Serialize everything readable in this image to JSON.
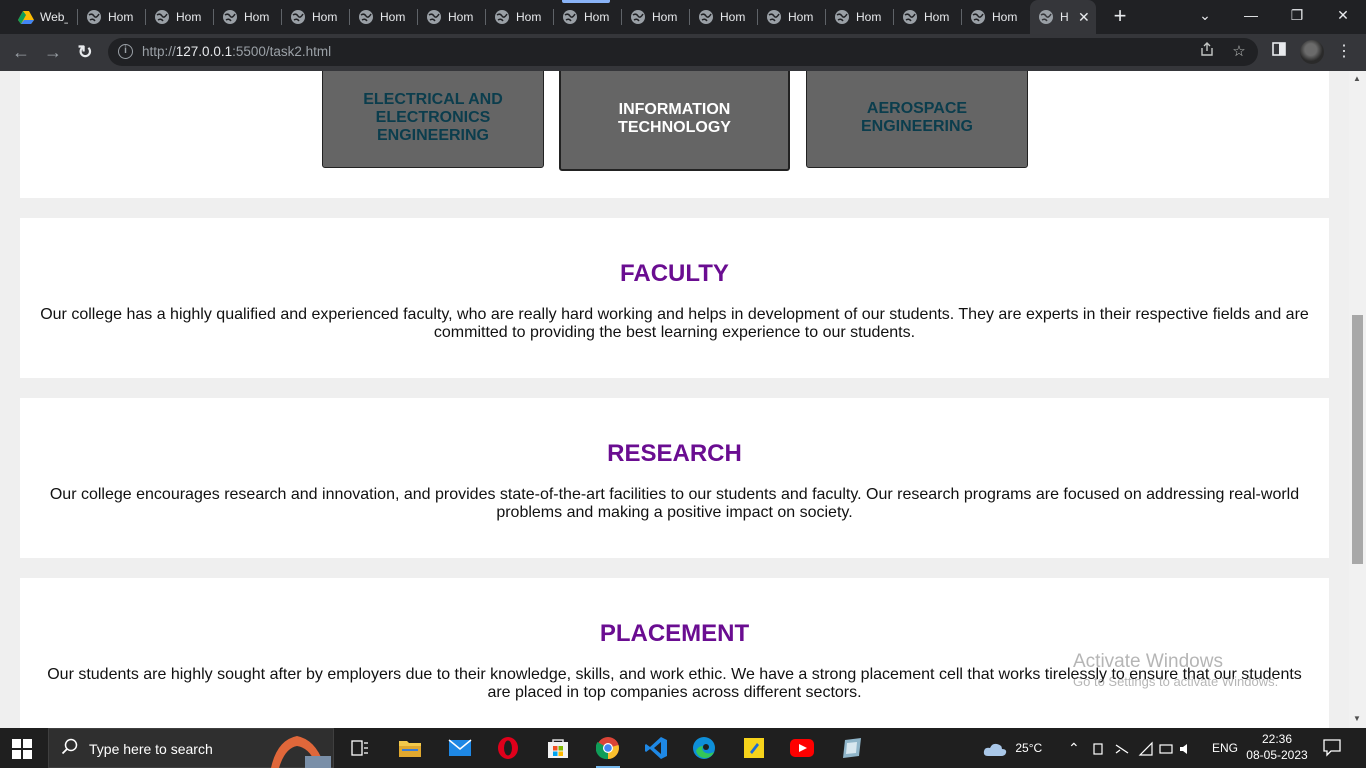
{
  "browser": {
    "tabs": [
      {
        "title": "Web_",
        "icon": "google-drive-icon"
      },
      {
        "title": "Hom",
        "icon": "globe-icon"
      },
      {
        "title": "Hom",
        "icon": "globe-icon"
      },
      {
        "title": "Hom",
        "icon": "globe-icon"
      },
      {
        "title": "Hom",
        "icon": "globe-icon"
      },
      {
        "title": "Hom",
        "icon": "globe-icon"
      },
      {
        "title": "Hom",
        "icon": "globe-icon"
      },
      {
        "title": "Hom",
        "icon": "globe-icon"
      },
      {
        "title": "Hom",
        "icon": "globe-icon"
      },
      {
        "title": "Hom",
        "icon": "globe-icon"
      },
      {
        "title": "Hom",
        "icon": "globe-icon"
      },
      {
        "title": "Hom",
        "icon": "globe-icon"
      },
      {
        "title": "Hom",
        "icon": "globe-icon"
      },
      {
        "title": "Hom",
        "icon": "globe-icon"
      },
      {
        "title": "Hom",
        "icon": "globe-icon"
      }
    ],
    "active_tab": {
      "title": "H",
      "close": "✕"
    },
    "new_tab": "+",
    "window_controls": {
      "dropdown": "⌄",
      "minimize": "—",
      "restore": "❐",
      "close": "✕"
    },
    "address": {
      "prefix": "http://",
      "host": "127.0.0.1",
      "rest": ":5500/task2.html"
    },
    "nav": {
      "back": "←",
      "forward": "→",
      "reload": "↻"
    }
  },
  "page": {
    "departments": [
      {
        "label": "ELECTRICAL AND ELECTRONICS ENGINEERING",
        "style": "dark"
      },
      {
        "label": "INFORMATION TECHNOLOGY",
        "style": "light"
      },
      {
        "label": "AEROSPACE ENGINEERING",
        "style": "dark"
      }
    ],
    "faculty": {
      "title": "FACULTY",
      "text": "Our college has a highly qualified and experienced faculty, who are really hard working and helps in development of our students. They are experts in their respective fields and are committed to providing the best learning experience to our students."
    },
    "research": {
      "title": "RESEARCH",
      "text": "Our college encourages research and innovation, and provides state-of-the-art facilities to our students and faculty. Our research programs are focused on addressing real-world problems and making a positive impact on society."
    },
    "placement": {
      "title": "PLACEMENT",
      "text": "Our students are highly sought after by employers due to their knowledge, skills, and work ethic. We have a strong placement cell that works tirelessly to ensure that our students are placed in top companies across different sectors."
    }
  },
  "watermark": {
    "line1": "Activate Windows",
    "line2": "Go to Settings to activate Windows."
  },
  "taskbar": {
    "search_placeholder": "Type here to search",
    "weather": "25°C",
    "language": "ENG",
    "time": "22:36",
    "date": "08-05-2023",
    "apps": [
      "task-view-icon",
      "file-explorer-icon",
      "mail-icon",
      "opera-icon",
      "microsoft-store-icon",
      "chrome-icon",
      "vscode-icon",
      "edge-icon",
      "sticky-notes-icon",
      "youtube-icon",
      "windows-app-icon"
    ]
  }
}
